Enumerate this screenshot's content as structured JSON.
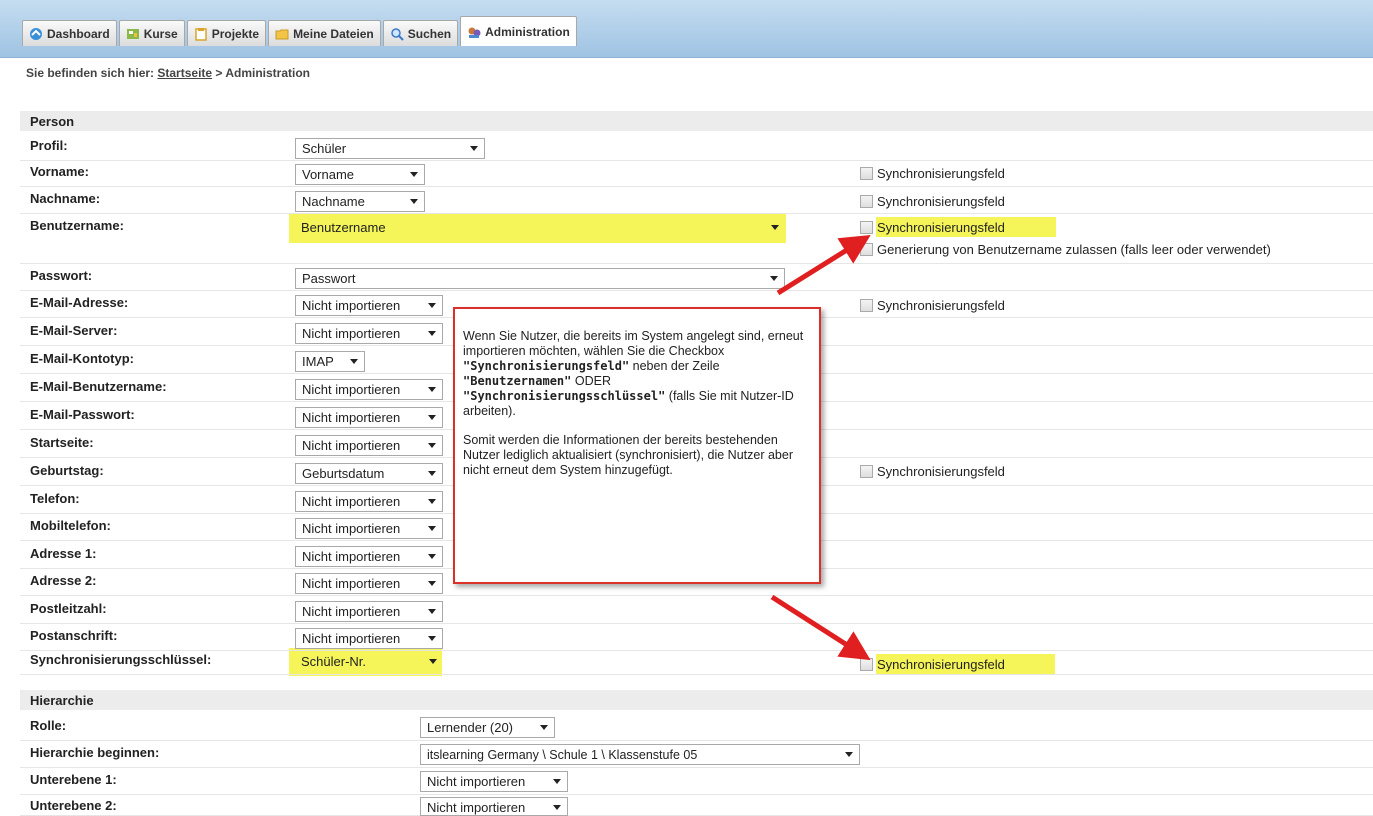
{
  "tabs": [
    {
      "label": "Dashboard",
      "icon": "dashboard-icon"
    },
    {
      "label": "Kurse",
      "icon": "courses-icon"
    },
    {
      "label": "Projekte",
      "icon": "projects-icon"
    },
    {
      "label": "Meine Dateien",
      "icon": "folder-icon"
    },
    {
      "label": "Suchen",
      "icon": "search-icon"
    },
    {
      "label": "Administration",
      "icon": "admin-icon"
    }
  ],
  "breadcrumb": {
    "prefix": "Sie befinden sich hier:",
    "link": "Startseite",
    "current": "> Administration"
  },
  "sections": {
    "person": "Person",
    "hierarchy": "Hierarchie"
  },
  "sync_label": "Synchronisierungsfeld",
  "generation_label": "Generierung von Benutzername zulassen (falls leer oder verwendet)",
  "person_rows": [
    {
      "label": "Profil:",
      "value": "Schüler"
    },
    {
      "label": "Vorname:",
      "value": "Vorname"
    },
    {
      "label": "Nachname:",
      "value": "Nachname"
    },
    {
      "label": "Benutzername:",
      "value": "Benutzername"
    },
    {
      "label": "Passwort:",
      "value": "Passwort"
    },
    {
      "label": "E-Mail-Adresse:",
      "value": "Nicht importieren"
    },
    {
      "label": "E-Mail-Server:",
      "value": "Nicht importieren"
    },
    {
      "label": "E-Mail-Kontotyp:",
      "value": "IMAP"
    },
    {
      "label": "E-Mail-Benutzername:",
      "value": "Nicht importieren"
    },
    {
      "label": "E-Mail-Passwort:",
      "value": "Nicht importieren"
    },
    {
      "label": "Startseite:",
      "value": "Nicht importieren"
    },
    {
      "label": "Geburtstag:",
      "value": "Geburtsdatum"
    },
    {
      "label": "Telefon:",
      "value": "Nicht importieren"
    },
    {
      "label": "Mobiltelefon:",
      "value": "Nicht importieren"
    },
    {
      "label": "Adresse 1:",
      "value": "Nicht importieren"
    },
    {
      "label": "Adresse 2:",
      "value": "Nicht importieren"
    },
    {
      "label": "Postleitzahl:",
      "value": "Nicht importieren"
    },
    {
      "label": "Postanschrift:",
      "value": "Nicht importieren"
    },
    {
      "label": "Synchronisierungsschlüssel:",
      "value": "Schüler-Nr."
    }
  ],
  "hierarchy_rows": [
    {
      "label": "Rolle:",
      "value": "Lernender  (20)"
    },
    {
      "label": "Hierarchie beginnen:",
      "value": "itslearning Germany \\ Schule 1 \\ Klassenstufe 05"
    },
    {
      "label": "Unterebene 1:",
      "value": "Nicht importieren"
    },
    {
      "label": "Unterebene 2:",
      "value": "Nicht importieren"
    }
  ],
  "callout": {
    "p1_a": "Wenn Sie Nutzer, die bereits im System angelegt sind, erneut importieren möchten, wählen Sie die Checkbox",
    "p1_b": "\"Synchronisierungsfeld\"",
    "p1_c": "neben der Zeile",
    "p1_d": "\"Benutzernamen\"",
    "p1_e": "ODER",
    "p1_f": "\"Synchronisierungsschlüssel\"",
    "p1_g": "(falls Sie mit Nutzer-ID arbeiten).",
    "p2": "Somit werden die Informationen der bereits bestehenden Nutzer lediglich aktualisiert (synchronisiert), die Nutzer aber nicht erneut dem System hinzugefügt."
  },
  "colors": {
    "highlight": "#f5f55a",
    "arrow": "#e02020",
    "callout_border": "#d9302a"
  }
}
